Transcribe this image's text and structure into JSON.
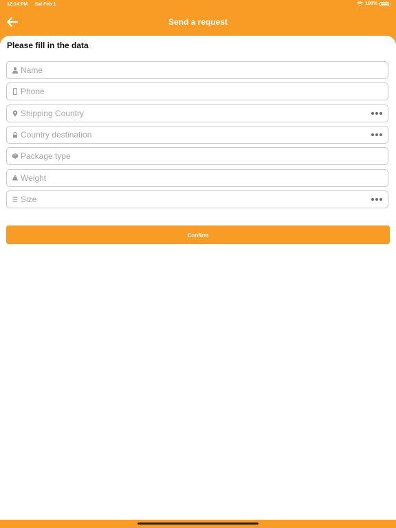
{
  "status_bar": {
    "time": "12:14 PM",
    "date": "Sat Feb 1",
    "battery": "100%"
  },
  "header": {
    "title": "Send a request"
  },
  "form": {
    "title": "Please fill in the data",
    "fields": [
      {
        "placeholder": "Name",
        "icon": "person-icon"
      },
      {
        "placeholder": "Phone",
        "icon": "phone-icon"
      },
      {
        "placeholder": "Shipping Country",
        "icon": "location-pin-icon",
        "picker": true
      },
      {
        "placeholder": "Country destination",
        "icon": "lock-icon",
        "picker": true
      },
      {
        "placeholder": "Package type",
        "icon": "package-icon"
      },
      {
        "placeholder": "Weight",
        "icon": "weight-icon"
      },
      {
        "placeholder": "Size",
        "icon": "list-icon",
        "picker": true
      }
    ],
    "confirm_label": "Confirm"
  },
  "colors": {
    "accent": "#f89c25",
    "border": "#c9c9c9",
    "placeholder": "#a5a5a5"
  }
}
